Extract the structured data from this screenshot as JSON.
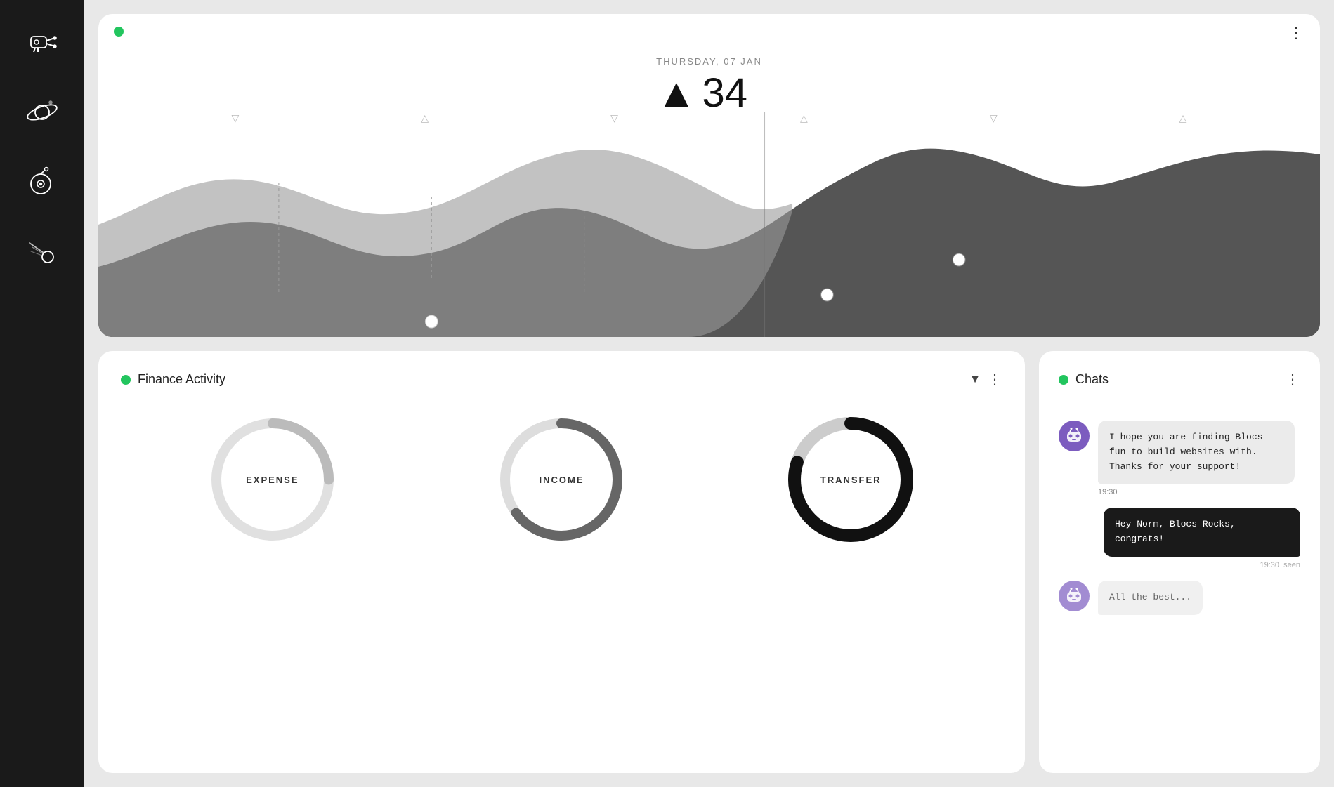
{
  "sidebar": {
    "icons": [
      {
        "name": "robot-gun-icon",
        "label": "Robot Gun"
      },
      {
        "name": "planet-icon",
        "label": "Planet"
      },
      {
        "name": "vinyl-record-icon",
        "label": "Vinyl Record"
      },
      {
        "name": "meteor-icon",
        "label": "Meteor"
      }
    ]
  },
  "chart_card": {
    "green_dot": true,
    "menu_label": "⋮",
    "date_label": "THURSDAY, 07 JAN",
    "value": "34",
    "arrow": "▲"
  },
  "triangle_markers": [
    "▽",
    "△",
    "▽",
    "△",
    "▽",
    "△"
  ],
  "finance": {
    "title": "Finance Activity",
    "dropdown_icon": "▼",
    "more_icon": "⋮",
    "green_dot": true,
    "items": [
      {
        "label": "EXPENSE",
        "progress": 0.25,
        "color": "#cccccc",
        "track": "#eeeeee"
      },
      {
        "label": "INCOME",
        "progress": 0.65,
        "color": "#555555",
        "track": "#dddddd"
      },
      {
        "label": "TRANSFER",
        "progress": 0.8,
        "color": "#111111",
        "track": "#cccccc"
      }
    ]
  },
  "chats": {
    "title": "Chats",
    "green_dot": true,
    "more_icon": "⋮",
    "messages": [
      {
        "type": "received",
        "avatar": "bot",
        "text": "I hope you are finding Blocs fun to  build  websites  with. Thanks for your support!",
        "time": "19:30"
      },
      {
        "type": "sent",
        "text": "Hey  Norm,  Blocs  Rocks, congrats!",
        "time": "19:30",
        "status": "seen"
      },
      {
        "type": "received",
        "avatar": "bot",
        "text": "All the best...",
        "time": ""
      }
    ]
  }
}
